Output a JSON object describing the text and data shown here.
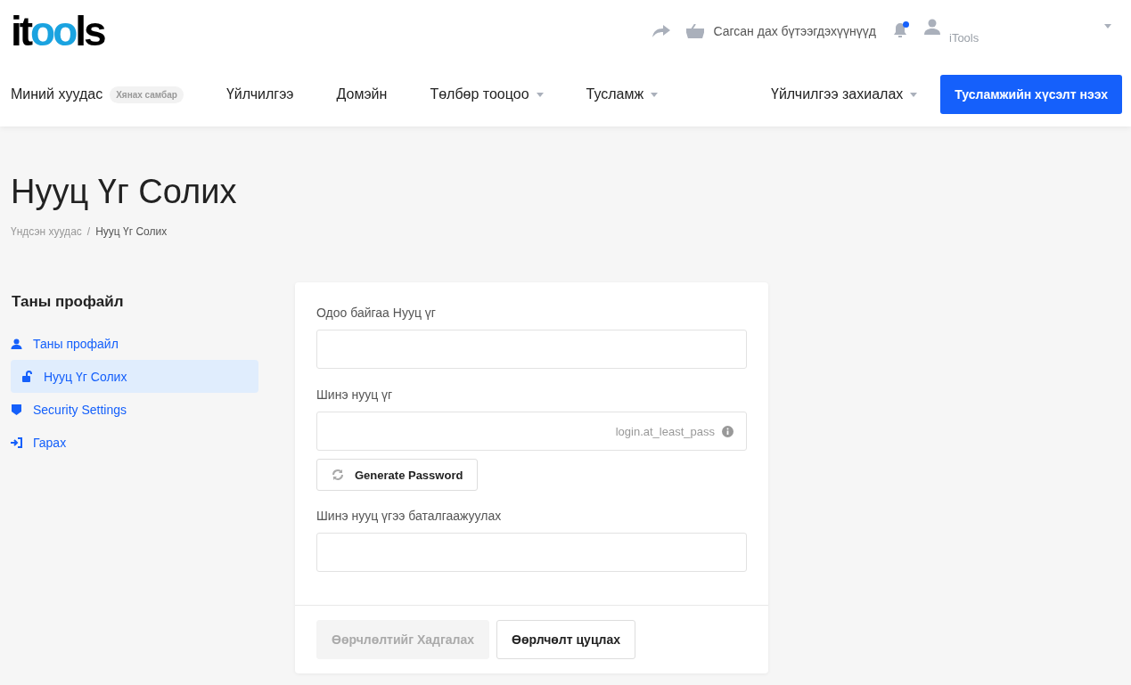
{
  "logo": {
    "prefix": "it",
    "highlight": "oo",
    "suffix": "ls"
  },
  "topbar": {
    "cart_label": "Сагсан дах бүтээгдэхүүнүүд",
    "notifications": {
      "unread": true
    },
    "user": {
      "name": "iTools"
    }
  },
  "nav": {
    "items": [
      {
        "label": "Миний хуудас",
        "badge": "Хянах самбар",
        "dropdown": false
      },
      {
        "label": "Үйлчилгээ",
        "dropdown": false
      },
      {
        "label": "Домэйн",
        "dropdown": false
      },
      {
        "label": "Төлбөр тооцоо",
        "dropdown": true
      },
      {
        "label": "Тусламж",
        "dropdown": true
      }
    ],
    "order": {
      "label": "Үйлчилгээ захиалах",
      "dropdown": true
    },
    "cta": "Тусламжийн хүсэлт нээх"
  },
  "page": {
    "title": "Нууц Үг Солих",
    "breadcrumb_separator": "/",
    "breadcrumb": [
      {
        "label": "Үндсэн хуудас",
        "selected": false
      },
      {
        "label": "Нууц Үг Солих",
        "selected": true
      }
    ]
  },
  "sidebar": {
    "heading": "Таны профайл",
    "items": [
      {
        "kind": "user",
        "label": "Таны профайл",
        "selected": false
      },
      {
        "kind": "lock",
        "label": "Нууц Үг Солих",
        "selected": true
      },
      {
        "kind": "shield",
        "label": "Security Settings",
        "selected": false
      },
      {
        "kind": "logout",
        "label": "Гарах",
        "selected": false
      }
    ]
  },
  "form": {
    "fields": [
      {
        "label": "Одоо байгаа Нууц үг"
      },
      {
        "label": "Шинэ нууц үг",
        "hint": "login.at_least_pass",
        "generate": "Generate Password"
      },
      {
        "label": "Шинэ нууц үгээ баталгаажуулах"
      }
    ],
    "save": {
      "label": "Өөрчлөлтийг Хадгалах",
      "disabled": true
    },
    "cancel": "Өөрлчөлт цуцлах"
  }
}
